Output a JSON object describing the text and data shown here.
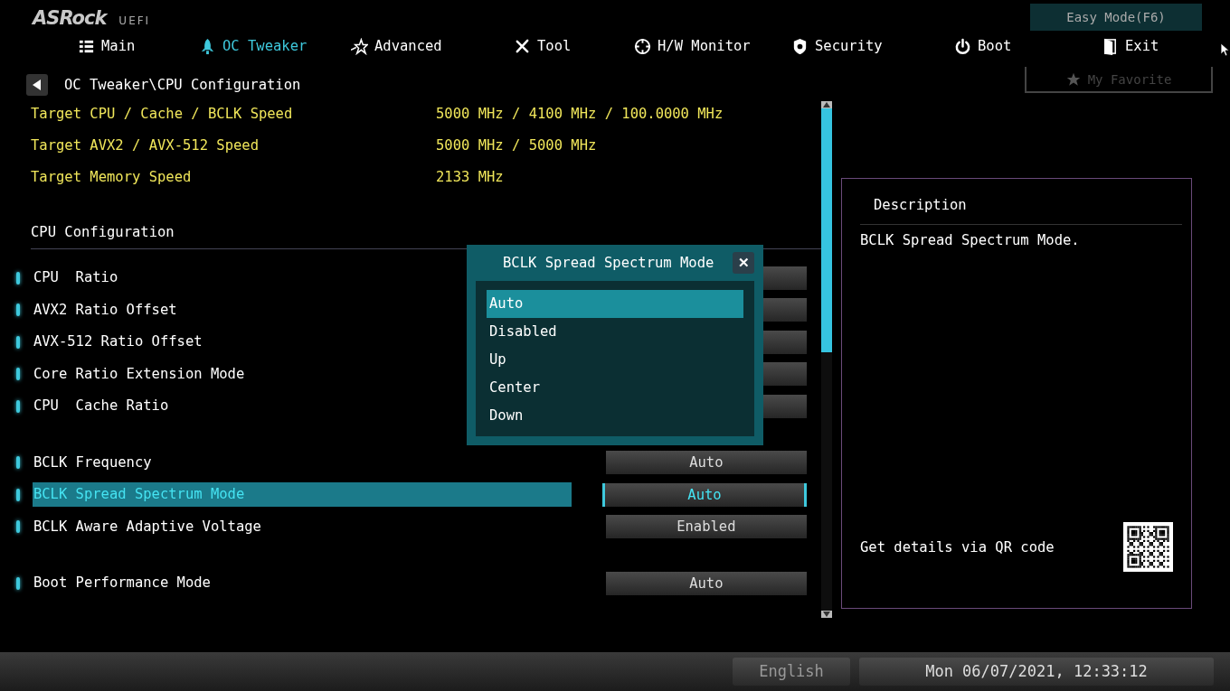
{
  "logo": {
    "brand": "ASRock",
    "sub": "UEFI"
  },
  "easy_mode_button": "Easy Mode(F6)",
  "tabs": [
    {
      "label": "Main",
      "selected": false
    },
    {
      "label": "OC Tweaker",
      "selected": true
    },
    {
      "label": "Advanced",
      "selected": false
    },
    {
      "label": "Tool",
      "selected": false
    },
    {
      "label": "H/W Monitor",
      "selected": false
    },
    {
      "label": "Security",
      "selected": false
    },
    {
      "label": "Boot",
      "selected": false
    },
    {
      "label": "Exit",
      "selected": false
    }
  ],
  "breadcrumb": "OC Tweaker\\CPU Configuration",
  "favorite_button": "My Favorite",
  "targets": [
    {
      "label": "Target CPU / Cache / BCLK Speed",
      "value": "5000 MHz / 4100 MHz / 100.0000 MHz"
    },
    {
      "label": "Target AVX2 / AVX-512 Speed",
      "value": "5000 MHz / 5000 MHz"
    },
    {
      "label": "Target Memory Speed",
      "value": "2133 MHz"
    }
  ],
  "section_heading": "CPU Configuration",
  "setting_groups": [
    {
      "items": [
        {
          "label": "CPU  Ratio",
          "selected": false
        },
        {
          "label": "AVX2 Ratio Offset",
          "selected": false
        },
        {
          "label": "AVX-512 Ratio Offset",
          "selected": false
        },
        {
          "label": "Core Ratio Extension Mode",
          "selected": false
        },
        {
          "label": "CPU  Cache Ratio",
          "selected": false
        }
      ]
    },
    {
      "items": [
        {
          "label": "BCLK Frequency",
          "value": "Auto",
          "selected": false
        },
        {
          "label": "BCLK Spread Spectrum Mode",
          "value": "Auto",
          "selected": true
        },
        {
          "label": "BCLK Aware Adaptive Voltage",
          "value": "Enabled",
          "selected": false
        }
      ]
    },
    {
      "items": [
        {
          "label": "Boot Performance Mode",
          "value": "Auto",
          "selected": false
        }
      ]
    }
  ],
  "dialog": {
    "title": "BCLK Spread Spectrum Mode",
    "close": "✕",
    "options": [
      {
        "label": "Auto",
        "selected": true
      },
      {
        "label": "Disabled",
        "selected": false
      },
      {
        "label": "Up",
        "selected": false
      },
      {
        "label": "Center",
        "selected": false
      },
      {
        "label": "Down",
        "selected": false
      }
    ]
  },
  "description": {
    "title": "Description",
    "text": "BCLK Spread Spectrum Mode.",
    "qr_caption": "Get details via QR code"
  },
  "status_bar": {
    "language": "English",
    "datetime": "Mon 06/07/2021, 12:33:12"
  }
}
